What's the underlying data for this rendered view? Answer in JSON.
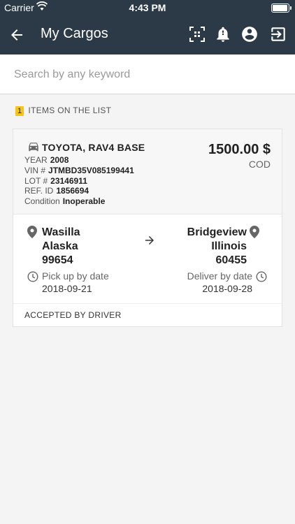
{
  "status_bar": {
    "carrier": "Carrier",
    "time": "4:43 PM"
  },
  "nav": {
    "title": "My Cargos",
    "icons": [
      "back-arrow-icon",
      "scan-icon",
      "bell-icon",
      "account-icon",
      "logout-icon"
    ]
  },
  "search": {
    "placeholder": "Search by any keyword",
    "value": ""
  },
  "list": {
    "count": "1",
    "count_label": "ITEMS ON THE LIST"
  },
  "cargos": [
    {
      "vehicle": "TOYOTA, RAV4 BASE",
      "year_label": "YEAR",
      "year": "2008",
      "vin_label": "VIN #",
      "vin": "JTMBD35V085199441",
      "lot_label": "LOT #",
      "lot": "23146911",
      "ref_label": "REF. ID",
      "ref": "1856694",
      "condition_label": "Condition",
      "condition": "Inoperable",
      "price": "1500.00 $",
      "payment": "COD",
      "pickup": {
        "city": "Wasilla",
        "state": "Alaska",
        "zip": "99654",
        "label": "Pick up by date",
        "date": "2018-09-21"
      },
      "delivery": {
        "city": "Bridgeview",
        "state": "Illinois",
        "zip": "60455",
        "label": "Deliver by date",
        "date": "2018-09-28"
      },
      "status": "ACCEPTED BY DRIVER"
    }
  ],
  "colors": {
    "header": "#2c3a47",
    "badge": "#f5c518",
    "background": "#f4f4f4"
  }
}
